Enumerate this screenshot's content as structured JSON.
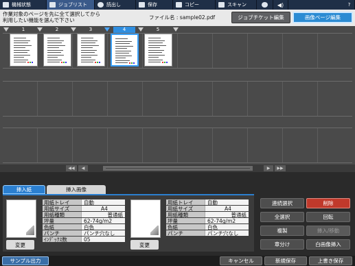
{
  "topnav": {
    "items": [
      {
        "label": "機械状態",
        "icon": "printer-icon"
      },
      {
        "label": "ジョブリスト",
        "icon": "list-icon",
        "active": true
      },
      {
        "label": "読出し",
        "icon": "folder-icon"
      },
      {
        "label": "保存",
        "icon": "save-icon"
      },
      {
        "label": "コピー",
        "icon": "copy-icon"
      },
      {
        "label": "スキャン",
        "icon": "scan-icon"
      },
      {
        "label": "",
        "icon": "globe-icon"
      },
      {
        "label": "",
        "icon": "volume-icon"
      },
      {
        "label": "?",
        "icon": "help-icon"
      }
    ]
  },
  "header": {
    "instruction_line1": "作業対象のページを先に全て選択してから",
    "instruction_line2": "利用したい機能を選んで下さい",
    "filename": "ファイル名 : sample02.pdf",
    "job_ticket_label": "ジョブチケット編集",
    "image_page_label": "画像ページ編集"
  },
  "pages": [
    {
      "num": "1",
      "selected": false
    },
    {
      "num": "2",
      "selected": false
    },
    {
      "num": "3",
      "selected": false
    },
    {
      "num": "4",
      "selected": true
    },
    {
      "num": "5",
      "selected": false
    }
  ],
  "scrollbar": {
    "first": "◀◀",
    "prev": "◀",
    "next": "▶",
    "last": "▶▶"
  },
  "tabs": {
    "insert_paper": "挿入紙",
    "insert_image": "挿入画像"
  },
  "paper_left": {
    "change_label": "変更",
    "rows": [
      {
        "k": "用紙トレイ",
        "v": "自動"
      },
      {
        "k": "用紙サイズ",
        "v": "A4"
      },
      {
        "k": "用紙種類",
        "v": "普通紙"
      },
      {
        "k": "坪量",
        "v": "62-74g/m2"
      },
      {
        "k": "色紙",
        "v": "白色"
      },
      {
        "k": "パンチ",
        "v": "パンチ穴なし"
      },
      {
        "k": "ｲﾝﾃﾞｯｸｽ数",
        "v": "05"
      }
    ]
  },
  "paper_right": {
    "change_label": "変更",
    "rows": [
      {
        "k": "用紙トレイ",
        "v": "自動"
      },
      {
        "k": "用紙サイズ",
        "v": "A4"
      },
      {
        "k": "用紙種類",
        "v": "普通紙"
      },
      {
        "k": "坪量",
        "v": "62-74g/m2"
      },
      {
        "k": "色紙",
        "v": "白色"
      },
      {
        "k": "パンチ",
        "v": "パンチ穴なし"
      }
    ]
  },
  "actions": {
    "continuous_select": "連続選択",
    "delete": "削除",
    "select_all": "全選択",
    "rotate": "回転",
    "duplicate": "複製",
    "insert_move": "挿入/移動",
    "chapter": "章分け",
    "blank_insert": "白画像挿入"
  },
  "footer": {
    "sample_output": "サンプル出力",
    "cancel": "キャンセル",
    "save_new": "新規保存",
    "overwrite": "上書き保存"
  },
  "colors": {
    "accent": "#2b8bd3",
    "danger": "#c0392b",
    "nav": "#1f2f47"
  }
}
